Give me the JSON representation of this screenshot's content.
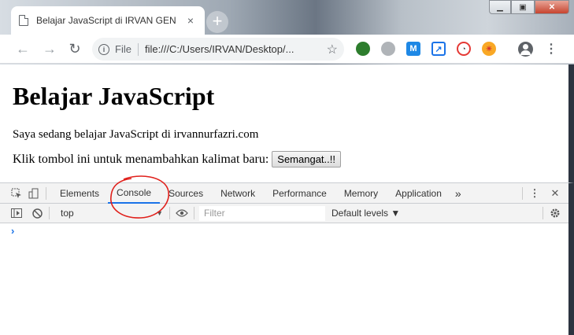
{
  "tab": {
    "title": "Belajar JavaScript di IRVAN GEN",
    "close": "×"
  },
  "newtab": "+",
  "window_controls": {
    "minimize": "▁",
    "maximize": "▣",
    "close": "✕"
  },
  "toolbar": {
    "back": "←",
    "forward": "→",
    "reload": "↻",
    "info": "i",
    "scheme": "File",
    "url": "file:///C:/Users/IRVAN/Desktop/...",
    "star": "☆",
    "menu": "⋮"
  },
  "page": {
    "heading": "Belajar JavaScript",
    "intro": "Saya sedang belajar JavaScript di irvannurfazri.com",
    "cta_text": "Klik tombol ini untuk menambahkan kalimat baru:",
    "button_label": "Semangat..!!"
  },
  "devtools": {
    "tabs": [
      "Elements",
      "Console",
      "Sources",
      "Network",
      "Performance",
      "Memory",
      "Application"
    ],
    "more": "»",
    "menu": "⋮",
    "close": "✕",
    "context": "top",
    "filter_placeholder": "Filter",
    "levels": "Default levels ▼",
    "prompt": "›"
  },
  "annotation_color": "#e0201b"
}
